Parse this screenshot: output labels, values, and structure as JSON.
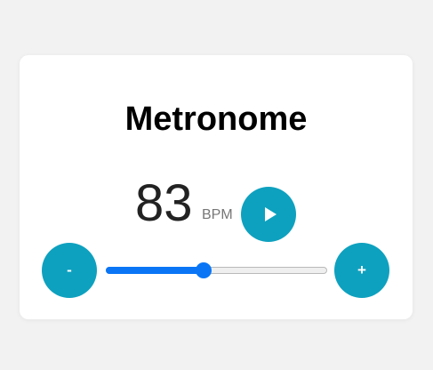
{
  "app": {
    "title": "Metronome"
  },
  "tempo": {
    "value": "83",
    "unit": "BPM"
  },
  "controls": {
    "play_icon": "play-icon",
    "minus_label": "-",
    "plus_label": "+"
  },
  "slider": {
    "fraction": 0.44
  },
  "colors": {
    "background": "#f2f2f2",
    "card": "#ffffff",
    "button": "#0ea1bf",
    "slider_accent": "#0a76f6"
  }
}
